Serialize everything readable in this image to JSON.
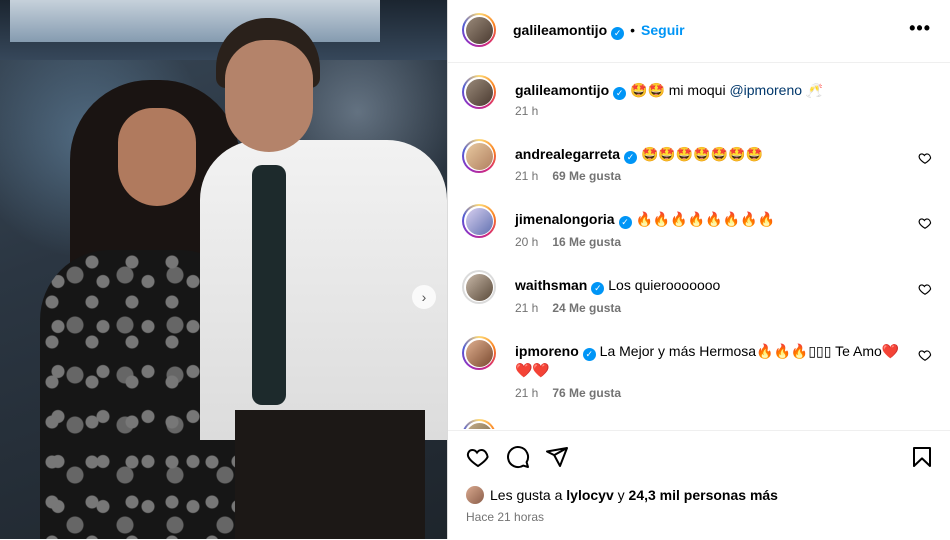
{
  "post": {
    "username": "galileamontijo",
    "follow_label": "Seguir",
    "more_label": "•••",
    "separator": "•"
  },
  "caption": {
    "username": "galileamontijo",
    "text_before": "🤩🤩 mi moqui ",
    "mention": "@ipmoreno",
    "text_after": " 🥂",
    "time": "21 h"
  },
  "comments": [
    {
      "username": "andrealegarreta",
      "text": "🤩🤩🤩🤩🤩🤩🤩",
      "time": "21 h",
      "likes": "69 Me gusta"
    },
    {
      "username": "jimenalongoria",
      "text": "🔥🔥🔥🔥🔥🔥🔥🔥",
      "time": "20 h",
      "likes": "16 Me gusta"
    },
    {
      "username": "waithsman",
      "text": "Los quierooooooo",
      "time": "21 h",
      "likes": "24 Me gusta"
    },
    {
      "username": "ipmoreno",
      "text": "La Mejor y más Hermosa🔥🔥🔥▯▯▯ Te Amo❤️",
      "text2": "❤️❤️",
      "time": "21 h",
      "likes": "76 Me gusta"
    }
  ],
  "footer": {
    "likes_prefix": "Les gusta a ",
    "likes_user": "lylocyv",
    "likes_mid": " y ",
    "likes_count": "24,3 mil personas más",
    "time": "Hace 21 horas"
  },
  "colors": {
    "accent": "#0095f6",
    "verified": "#0095f6",
    "muted": "#737373"
  },
  "icons": [
    "chevron-right-icon",
    "heart-icon",
    "comment-icon",
    "share-icon",
    "bookmark-icon",
    "verified-icon",
    "more-icon"
  ]
}
